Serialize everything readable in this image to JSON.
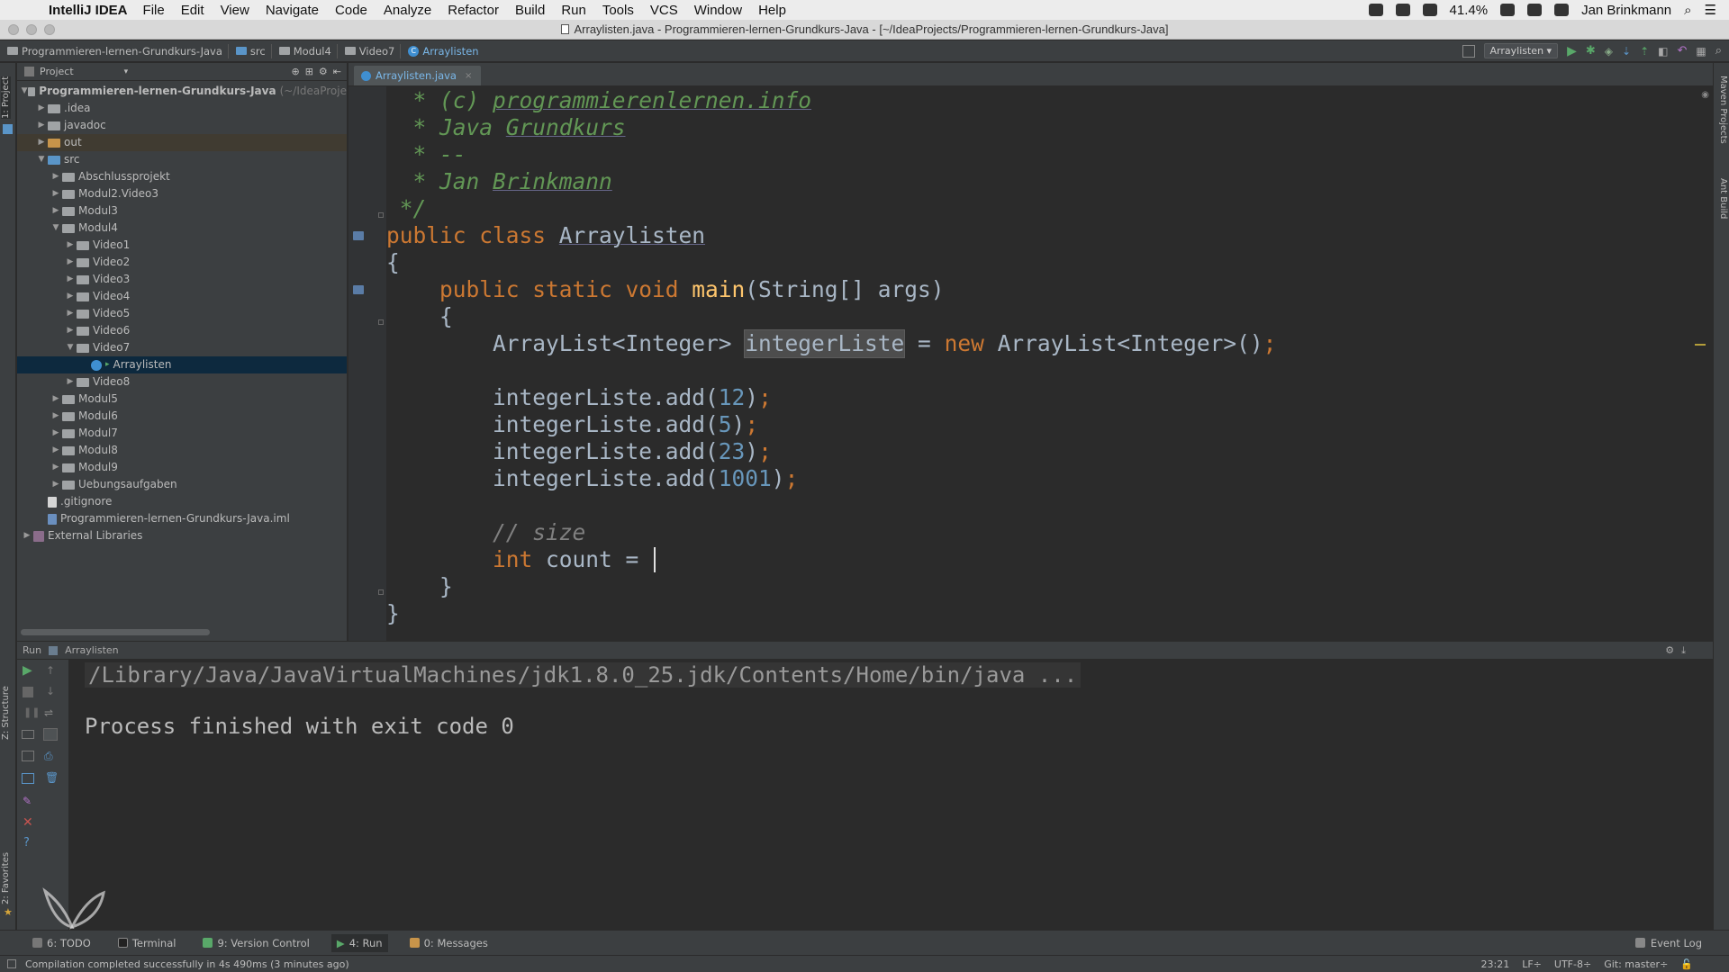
{
  "menubar": {
    "app_name": "IntelliJ IDEA",
    "items": [
      "File",
      "Edit",
      "View",
      "Navigate",
      "Code",
      "Analyze",
      "Refactor",
      "Build",
      "Run",
      "Tools",
      "VCS",
      "Window",
      "Help"
    ],
    "battery": "41.4%",
    "user": "Jan Brinkmann"
  },
  "window": {
    "title": "Arraylisten.java - Programmieren-lernen-Grundkurs-Java - [~/IdeaProjects/Programmieren-lernen-Grundkurs-Java]"
  },
  "navbar": {
    "crumbs": [
      "Programmieren-lernen-Grundkurs-Java",
      "src",
      "Modul4",
      "Video7",
      "Arraylisten"
    ],
    "run_config": "Arraylisten"
  },
  "project": {
    "header": "Project",
    "root": "Programmieren-lernen-Grundkurs-Java",
    "root_hint": "(~/IdeaProje",
    "items": [
      ".idea",
      "javadoc",
      "out",
      "src",
      "Abschlussprojekt",
      "Modul2.Video3",
      "Modul3",
      "Modul4",
      "Video1",
      "Video2",
      "Video3",
      "Video4",
      "Video5",
      "Video6",
      "Video7",
      "Arraylisten",
      "Video8",
      "Modul5",
      "Modul6",
      "Modul7",
      "Modul8",
      "Modul9",
      "Uebungsaufgaben",
      ".gitignore",
      "Programmieren-lernen-Grundkurs-Java.iml",
      "External Libraries"
    ]
  },
  "left_strip": {
    "project_tab": "1: Project",
    "structure_tab": "Z: Structure",
    "favorites_tab": "2: Favorites"
  },
  "right_strip": {
    "maven_tab": "Maven Projects",
    "ant_tab": "Ant Build"
  },
  "editor": {
    "tab": "Arraylisten.java",
    "line1_a": "* (c) ",
    "line1_b": "programmierenlernen.info",
    "line2_a": "* Java ",
    "line2_b": "Grundkurs",
    "line3": "* --",
    "line4_a": "* Jan ",
    "line4_b": "Brinkmann",
    "line5": "*/",
    "line6_kw": "public class ",
    "line6_name": "Arraylisten",
    "brace_open": "{",
    "line8_kw": "public static void ",
    "line8_fn": "main",
    "line8_rest": "(String[] args)",
    "inner_open": "{",
    "line10_a": "ArrayList<Integer> ",
    "line10_var": "integerListe",
    "line10_eq": " = ",
    "line10_new": "new ",
    "line10_rest": "ArrayList<Integer>()",
    "semi": ";",
    "add_prefix": "integerListe.add(",
    "add_values": [
      "12",
      "5",
      "23",
      "1001"
    ],
    "add_suffix": ")",
    "comment": "// size",
    "int_kw": "int",
    "int_rest": " count = ",
    "inner_close": "}",
    "brace_close": "}"
  },
  "run": {
    "header_label": "Run",
    "config": "Arraylisten",
    "output_line1": "/Library/Java/JavaVirtualMachines/jdk1.8.0_25.jdk/Contents/Home/bin/java ...",
    "output_line2": "Process finished with exit code 0"
  },
  "bottom_tabs": [
    {
      "label": "6: TODO"
    },
    {
      "label": "Terminal"
    },
    {
      "label": "9: Version Control"
    },
    {
      "label": "4: Run"
    },
    {
      "label": "0: Messages"
    }
  ],
  "event_log": "Event Log",
  "statusbar": {
    "message": "Compilation completed successfully in 4s 490ms (3 minutes ago)",
    "position": "23:21",
    "line_sep": "LF÷",
    "encoding": "UTF-8÷",
    "git": "Git: master÷"
  },
  "colors": {
    "bg": "#2b2b2b",
    "panel": "#3c3f41",
    "keyword": "#cc7832",
    "number": "#6897bb",
    "comment": "#629755",
    "function": "#ffc66d",
    "text": "#a9b7c6"
  }
}
